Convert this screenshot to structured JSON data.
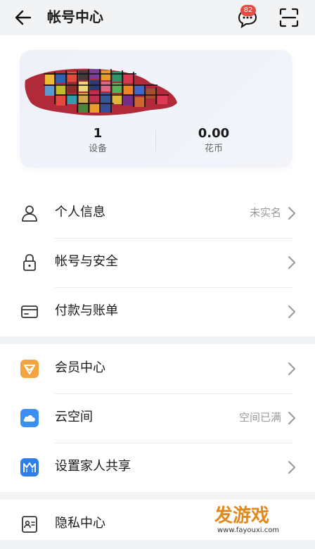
{
  "header": {
    "title": "帐号中心",
    "message_badge": "82"
  },
  "account_card": {
    "stats": [
      {
        "value": "1",
        "label": "设备"
      },
      {
        "value": "0.00",
        "label": "花币"
      }
    ]
  },
  "menu": {
    "personal_info": {
      "label": "个人信息",
      "value": "未实名"
    },
    "account_security": {
      "label": "帐号与安全"
    },
    "payment": {
      "label": "付款与账单"
    },
    "member": {
      "label": "会员中心"
    },
    "cloud": {
      "label": "云空间",
      "value": "空间已满"
    },
    "family_share": {
      "label": "设置家人共享"
    },
    "privacy": {
      "label": "隐私中心"
    }
  },
  "watermark": {
    "brand": "发游戏",
    "url": "www.fayouxi.com"
  },
  "colors": {
    "accent": "#e84a40",
    "member_icon": "#f3a340",
    "cloud_icon": "#3a8ff0",
    "family_icon": "#2e7de8"
  }
}
